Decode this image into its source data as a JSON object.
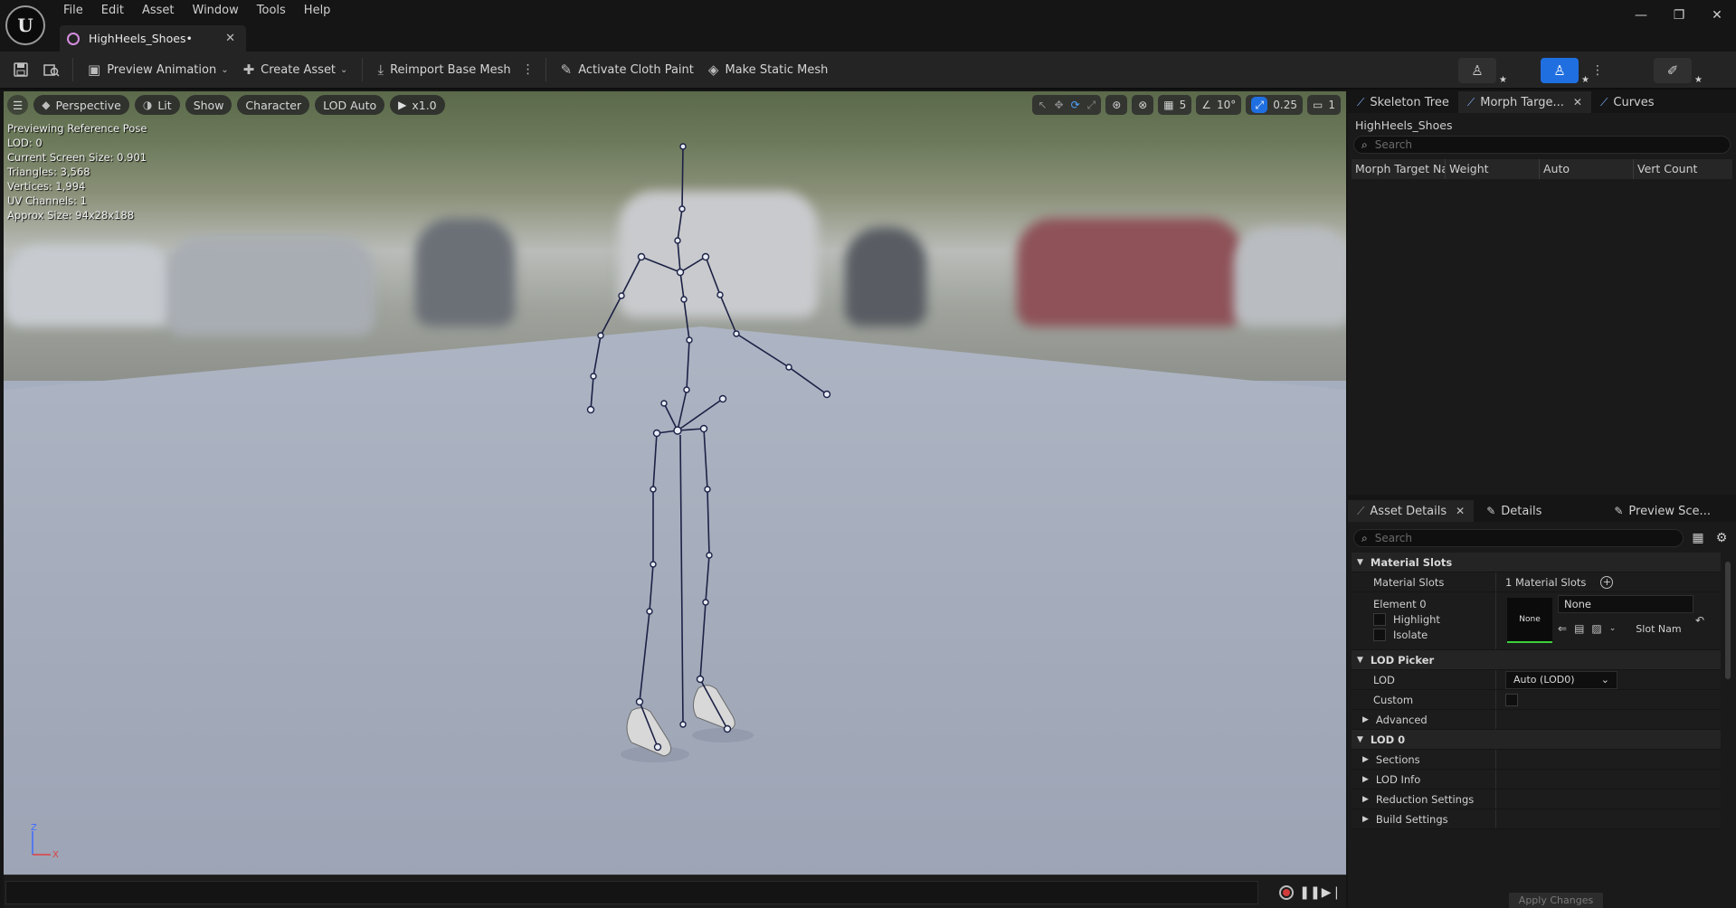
{
  "menu": [
    "File",
    "Edit",
    "Asset",
    "Window",
    "Tools",
    "Help"
  ],
  "document_tab": {
    "label": "HighHeels_Shoes•"
  },
  "window_controls": {
    "minimize": "—",
    "restore": "❐",
    "close": "✕"
  },
  "toolbar": {
    "preview_animation": "Preview Animation",
    "create_asset": "Create Asset",
    "reimport": "Reimport Base Mesh",
    "cloth_paint": "Activate Cloth Paint",
    "static_mesh": "Make Static Mesh"
  },
  "viewport": {
    "pills": {
      "perspective": "Perspective",
      "lit": "Lit",
      "show": "Show",
      "character": "Character",
      "lod": "LOD Auto",
      "speed": "x1.0"
    },
    "tools": {
      "grid": "5",
      "angle": "10°",
      "scale": "0.25",
      "camera": "1"
    },
    "stats": [
      "Previewing Reference Pose",
      "LOD: 0",
      "Current Screen Size: 0.901",
      "Triangles: 3,568",
      "Vertices: 1,994",
      "UV Channels: 1",
      "Approx Size: 94x28x188"
    ],
    "axis": {
      "z": "Z",
      "x": "X"
    }
  },
  "top_panel": {
    "tabs": [
      "Skeleton Tree",
      "Morph Targe...",
      "Curves"
    ],
    "title": "HighHeels_Shoes",
    "search_placeholder": "Search",
    "columns": [
      "Morph Target Na",
      "Weight",
      "Auto",
      "Vert Count"
    ]
  },
  "details_panel": {
    "tabs": [
      "Asset Details",
      "Details",
      "Preview Sce..."
    ],
    "search_placeholder": "Search",
    "material_slots": {
      "category": "Material Slots",
      "label": "Material Slots",
      "value": "1 Material Slots",
      "element": "Element 0",
      "highlight": "Highlight",
      "isolate": "Isolate",
      "thumb": "None",
      "material": "None",
      "slot_name": "Slot Nam"
    },
    "lod_picker": {
      "category": "LOD Picker",
      "lod_label": "LOD",
      "lod_value": "Auto (LOD0)",
      "custom_label": "Custom",
      "advanced": "Advanced"
    },
    "lod0": {
      "category": "LOD 0",
      "items": [
        "Sections",
        "LOD Info",
        "Reduction Settings",
        "Build Settings"
      ]
    },
    "apply": "Apply Changes"
  },
  "colors": {
    "accent": "#1f6fe0",
    "green_underline": "#3bd03b",
    "record": "#d23b3b"
  }
}
